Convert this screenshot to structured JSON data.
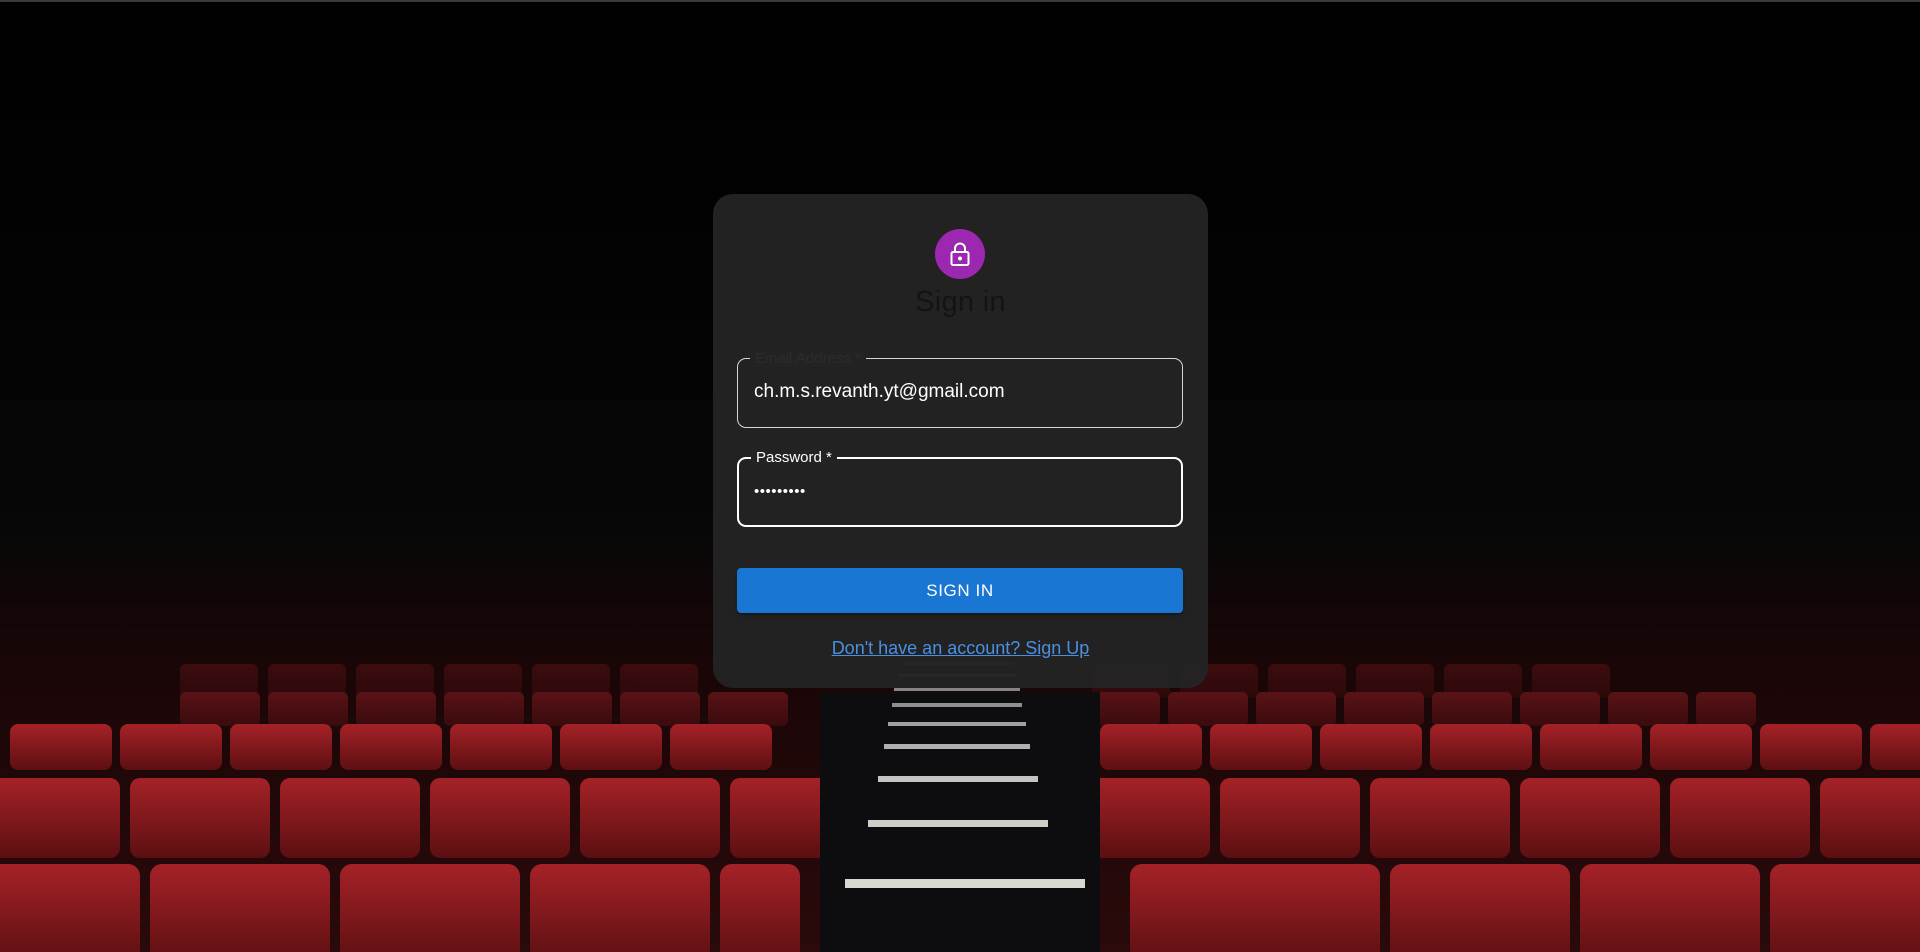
{
  "colors": {
    "avatar_bg": "#9c27b0",
    "primary_button": "#1976d2",
    "link": "#4a90e2",
    "seat_red": "#8e1a1e"
  },
  "background": {
    "description_icon": "cinema-seats-image"
  },
  "avatar": {
    "icon": "lock-icon"
  },
  "title": "Sign in",
  "email": {
    "label": "Email Address *",
    "value": "ch.m.s.revanth.yt@gmail.com"
  },
  "password": {
    "label": "Password *",
    "value": "•••••••••"
  },
  "signin_button": "SIGN IN",
  "signup_link": "Don't have an account? Sign Up"
}
